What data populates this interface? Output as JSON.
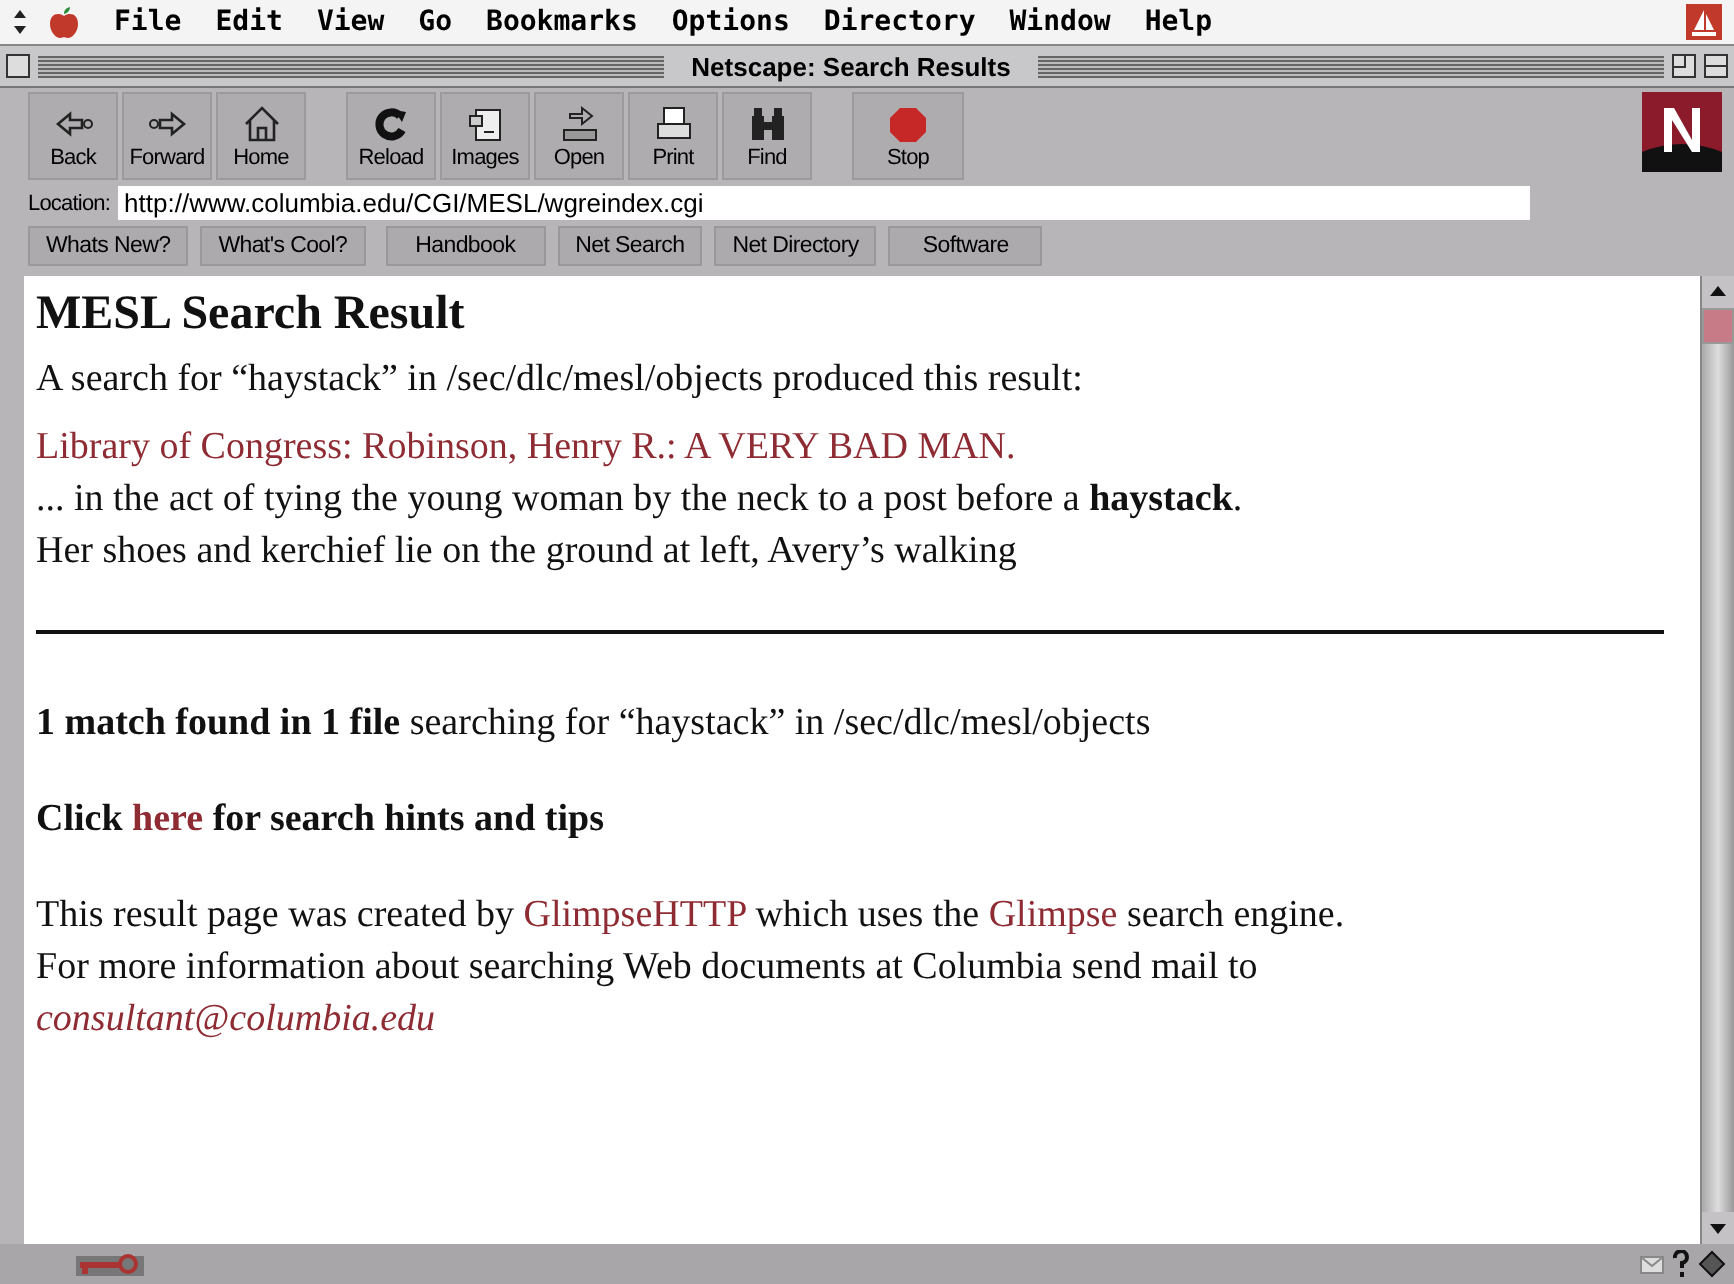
{
  "menu_bar": {
    "items": [
      "File",
      "Edit",
      "View",
      "Go",
      "Bookmarks",
      "Options",
      "Directory",
      "Window",
      "Help"
    ]
  },
  "window": {
    "title": "Netscape: Search Results"
  },
  "toolbar": {
    "buttons": [
      {
        "label": "Back",
        "kind": "back"
      },
      {
        "label": "Forward",
        "kind": "forward"
      },
      {
        "label": "Home",
        "kind": "home"
      },
      {
        "label": "Reload",
        "kind": "reload"
      },
      {
        "label": "Images",
        "kind": "images"
      },
      {
        "label": "Open",
        "kind": "open"
      },
      {
        "label": "Print",
        "kind": "print"
      },
      {
        "label": "Find",
        "kind": "find"
      },
      {
        "label": "Stop",
        "kind": "stop"
      }
    ]
  },
  "location": {
    "label": "Location:",
    "value": "http://www.columbia.edu/CGI/MESL/wgreindex.cgi"
  },
  "directory_buttons": [
    "Whats New?",
    "What's Cool?",
    "Handbook",
    "Net Search",
    "Net Directory",
    "Software"
  ],
  "content": {
    "heading": "MESL Search Result",
    "intro": "A search for “haystack” in /sec/dlc/mesl/objects produced this result:",
    "result_link": "Library of Congress: Robinson, Henry R.: A VERY BAD MAN.",
    "excerpt_lines": [
      "... in the act of tying the young woman by the neck to a post before a **haystack**.",
      "Her shoes and kerchief lie on the ground at left, Avery’s walking"
    ],
    "summary": "**1 match found in 1 file** searching for “haystack” in /sec/dlc/mesl/objects",
    "hint": [
      {
        "kind": "text",
        "text": "Click"
      },
      {
        "kind": "link",
        "text": "here"
      },
      {
        "kind": "text",
        "text": "for search hints and tips"
      }
    ],
    "footer_lines": [
      [
        {
          "kind": "text",
          "text": "This result page was created by"
        },
        {
          "kind": "link",
          "text": "GlimpseHTTP"
        },
        {
          "kind": "text",
          "text": "which uses the"
        },
        {
          "kind": "link",
          "text": "Glimpse"
        },
        {
          "kind": "text",
          "text": "search engine."
        }
      ],
      [
        {
          "kind": "text",
          "text": "For more information about searching Web documents at Columbia send mail to"
        }
      ],
      [
        {
          "kind": "email",
          "text": "consultant@columbia.edu"
        }
      ]
    ]
  }
}
